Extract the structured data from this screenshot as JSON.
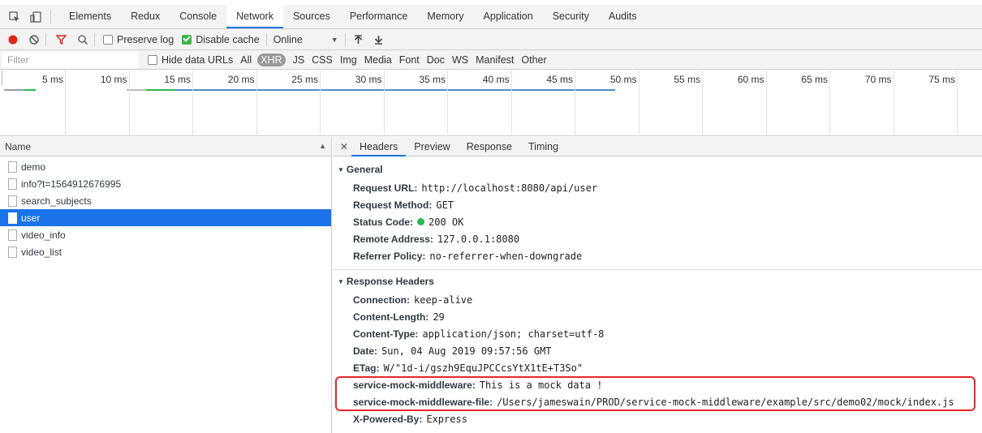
{
  "tabs": [
    "Elements",
    "Redux",
    "Console",
    "Network",
    "Sources",
    "Performance",
    "Memory",
    "Application",
    "Security",
    "Audits"
  ],
  "active_tab": "Network",
  "toolbar": {
    "preserve_log": "Preserve log",
    "disable_cache": "Disable cache",
    "throttle": "Online"
  },
  "filter": {
    "placeholder": "Filter",
    "hide_data_urls": "Hide data URLs",
    "types": [
      "All",
      "XHR",
      "JS",
      "CSS",
      "Img",
      "Media",
      "Font",
      "Doc",
      "WS",
      "Manifest",
      "Other"
    ],
    "active_type": "XHR"
  },
  "overview": {
    "ticks": [
      "5 ms",
      "10 ms",
      "15 ms",
      "20 ms",
      "25 ms",
      "30 ms",
      "35 ms",
      "40 ms",
      "45 ms",
      "50 ms",
      "55 ms",
      "60 ms",
      "65 ms",
      "70 ms",
      "75 ms"
    ]
  },
  "list": {
    "header": "Name",
    "rows": [
      "demo",
      "info?t=1564912676995",
      "search_subjects",
      "user",
      "video_info",
      "video_list"
    ],
    "selected": "user"
  },
  "detail": {
    "tabs": [
      "Headers",
      "Preview",
      "Response",
      "Timing"
    ],
    "active_tab": "Headers",
    "general_title": "General",
    "general": [
      {
        "key": "Request URL:",
        "value": "http://localhost:8080/api/user"
      },
      {
        "key": "Request Method:",
        "value": "GET"
      },
      {
        "key": "Status Code:",
        "value": "200 OK"
      },
      {
        "key": "Remote Address:",
        "value": "127.0.0.1:8080"
      },
      {
        "key": "Referrer Policy:",
        "value": "no-referrer-when-downgrade"
      }
    ],
    "response_title": "Response Headers",
    "response": [
      {
        "key": "Connection:",
        "value": "keep-alive"
      },
      {
        "key": "Content-Length:",
        "value": "29"
      },
      {
        "key": "Content-Type:",
        "value": "application/json; charset=utf-8"
      },
      {
        "key": "Date:",
        "value": "Sun, 04 Aug 2019 09:57:56 GMT"
      },
      {
        "key": "ETag:",
        "value": "W/\"1d-i/gszh9EquJPCCcsYtX1tE+T3So\""
      },
      {
        "key": "service-mock-middleware:",
        "value": "This is a mock data !"
      },
      {
        "key": "service-mock-middleware-file:",
        "value": "/Users/jameswain/PROD/service-mock-middleware/example/src/demo02/mock/index.js"
      },
      {
        "key": "X-Powered-By:",
        "value": "Express"
      }
    ]
  },
  "colors": {
    "accent": "#1a73e8",
    "record": "#e0251b",
    "status_ok": "#2db84d",
    "highlight": "#e6262c"
  }
}
